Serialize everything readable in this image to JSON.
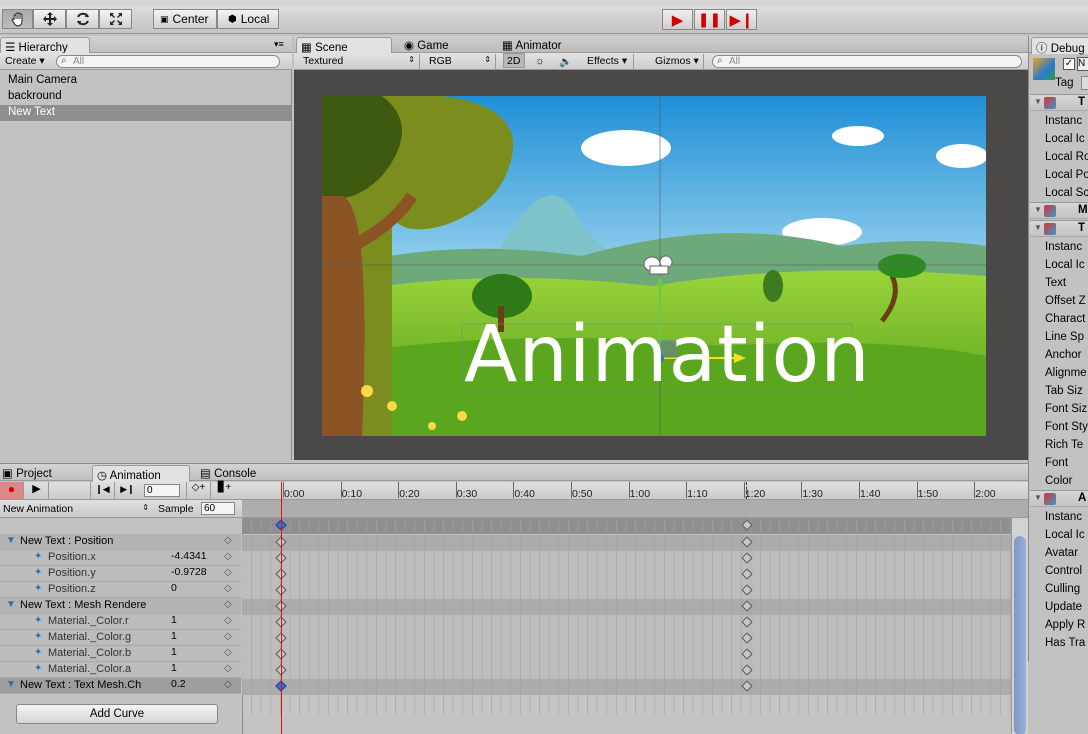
{
  "toolbar": {
    "tools": [
      "hand-tool",
      "move-tool",
      "rotate-tool",
      "scale-tool"
    ],
    "pivot_label": "Center",
    "space_label": "Local",
    "play_controls": [
      "play",
      "pause",
      "step"
    ]
  },
  "hierarchy": {
    "tab_label": "Hierarchy",
    "create_label": "Create",
    "search_placeholder": "All",
    "items": [
      {
        "label": "Main Camera",
        "selected": false
      },
      {
        "label": "backround",
        "selected": false
      },
      {
        "label": "New Text",
        "selected": true
      }
    ]
  },
  "scene": {
    "tabs": [
      {
        "label": "Scene",
        "active": true
      },
      {
        "label": "Game",
        "active": false
      },
      {
        "label": "Animator",
        "active": false
      }
    ],
    "shading_mode": "Textured",
    "render_mode": "RGB",
    "mode_2d": "2D",
    "effects_label": "Effects",
    "gizmos_label": "Gizmos",
    "search_placeholder": "All",
    "scene_text": "Animation"
  },
  "inspector": {
    "tab_label": "Debug",
    "tag_label": "Tag",
    "rows": [
      {
        "label": "T",
        "header": true
      },
      {
        "label": "Instanc"
      },
      {
        "label": "Local Ic"
      },
      {
        "label": "Local Ro"
      },
      {
        "label": "Local Po"
      },
      {
        "label": "Local Sc"
      },
      {
        "label": "M",
        "header": true
      },
      {
        "label": "T",
        "header": true
      },
      {
        "label": "Instanc"
      },
      {
        "label": "Local Ic"
      },
      {
        "label": "Text"
      },
      {
        "label": "Offset Z"
      },
      {
        "label": "Charact"
      },
      {
        "label": "Line Sp"
      },
      {
        "label": "Anchor"
      },
      {
        "label": "Alignme"
      },
      {
        "label": "Tab Siz"
      },
      {
        "label": "Font Siz"
      },
      {
        "label": "Font Sty"
      },
      {
        "label": "Rich Te"
      },
      {
        "label": "Font"
      },
      {
        "label": "Color"
      },
      {
        "label": "A",
        "header": true
      },
      {
        "label": "Instanc"
      },
      {
        "label": "Local Ic"
      },
      {
        "label": "Avatar"
      },
      {
        "label": "Control"
      },
      {
        "label": "Culling"
      },
      {
        "label": "Update"
      },
      {
        "label": "Apply R"
      },
      {
        "label": "Has Tra"
      }
    ]
  },
  "bottom": {
    "tabs": [
      {
        "label": "Project",
        "active": false
      },
      {
        "label": "Animation",
        "active": true
      },
      {
        "label": "Console",
        "active": false
      }
    ],
    "frame_value": "0",
    "clip_name": "New Animation",
    "sample_label": "Sample",
    "sample_value": "60",
    "add_curve_label": "Add Curve",
    "time_ticks": [
      "0:00",
      "0:10",
      "0:20",
      "0:30",
      "0:40",
      "0:50",
      "1:00",
      "1:10",
      "1:20",
      "1:30",
      "1:40",
      "1:50",
      "2:00"
    ],
    "properties": [
      {
        "label": "New Text : Position",
        "value": "",
        "group": true
      },
      {
        "label": "Position.x",
        "value": "-4.4341",
        "group": false
      },
      {
        "label": "Position.y",
        "value": "-0.9728",
        "group": false
      },
      {
        "label": "Position.z",
        "value": "0",
        "group": false
      },
      {
        "label": "New Text : Mesh Rendere",
        "value": "",
        "group": true
      },
      {
        "label": "Material._Color.r",
        "value": "1",
        "group": false
      },
      {
        "label": "Material._Color.g",
        "value": "1",
        "group": false
      },
      {
        "label": "Material._Color.b",
        "value": "1",
        "group": false
      },
      {
        "label": "Material._Color.a",
        "value": "1",
        "group": false
      },
      {
        "label": "New Text : Text Mesh.Ch",
        "value": "0.2",
        "group": true,
        "selected": true
      }
    ]
  },
  "colors": {
    "record_red": "#d40000",
    "selection_gray": "#8e8e8e",
    "playhead_red": "#e01010",
    "keyframe_blue": "#3a6fd8"
  }
}
